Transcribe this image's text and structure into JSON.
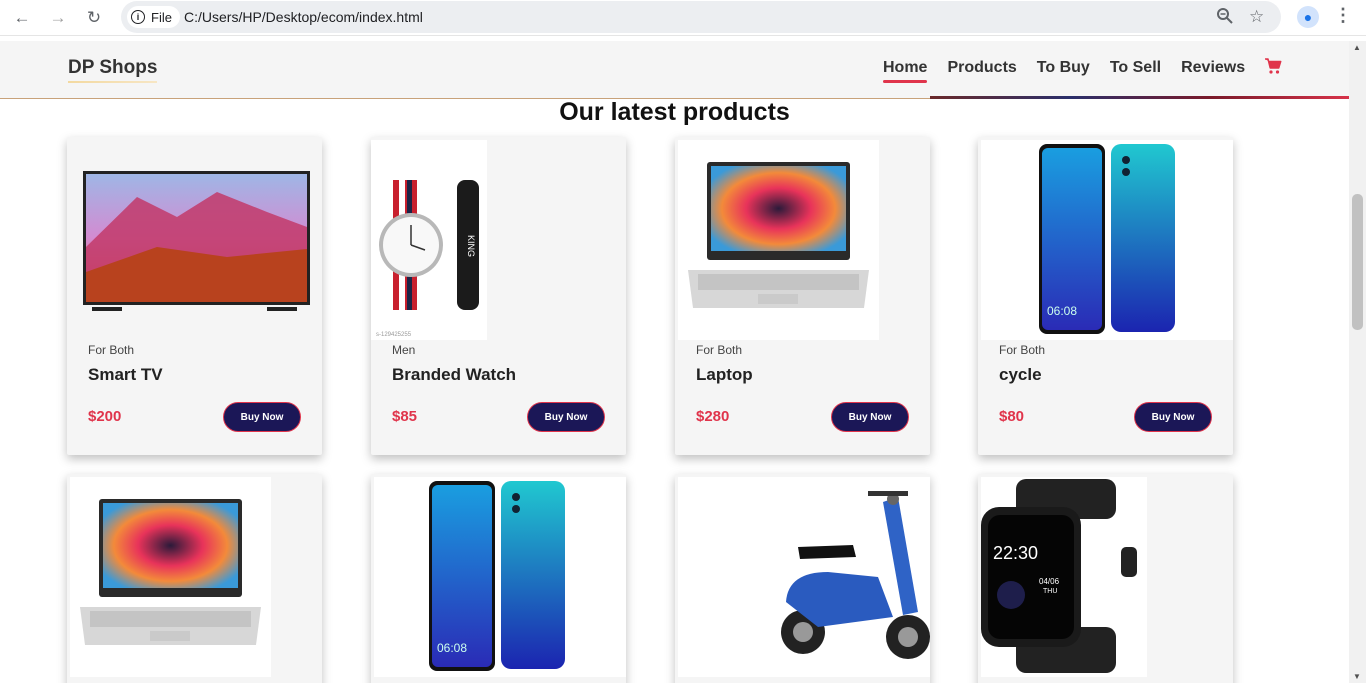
{
  "browser": {
    "file_label": "File",
    "url": "C:/Users/HP/Desktop/ecom/index.html"
  },
  "site": {
    "brand": "DP Shops",
    "nav": [
      "Home",
      "Products",
      "To Buy",
      "To Sell",
      "Reviews"
    ],
    "active_nav": "Home",
    "accent_color": "#e0344b",
    "button_color": "#1b1757"
  },
  "section_title": "Our latest products",
  "products": [
    {
      "category": "For Both",
      "name": "Smart TV",
      "price": "$200",
      "button": "Buy Now",
      "image": "smart-tv-image"
    },
    {
      "category": "Men",
      "name": "Branded Watch",
      "price": "$85",
      "button": "Buy Now",
      "image": "watch-image",
      "image_caption": "s-129425255"
    },
    {
      "category": "For Both",
      "name": "Laptop",
      "price": "$280",
      "button": "Buy Now",
      "image": "laptop-image"
    },
    {
      "category": "For Both",
      "name": "cycle",
      "price": "$80",
      "button": "Buy Now",
      "image": "smartphone-image"
    },
    {
      "image": "laptop-image"
    },
    {
      "image": "smartphone-image"
    },
    {
      "image": "scooter-image"
    },
    {
      "image": "smartwatch-image",
      "watch_time": "22:30",
      "watch_date": "04/06",
      "watch_day": "THU"
    }
  ]
}
